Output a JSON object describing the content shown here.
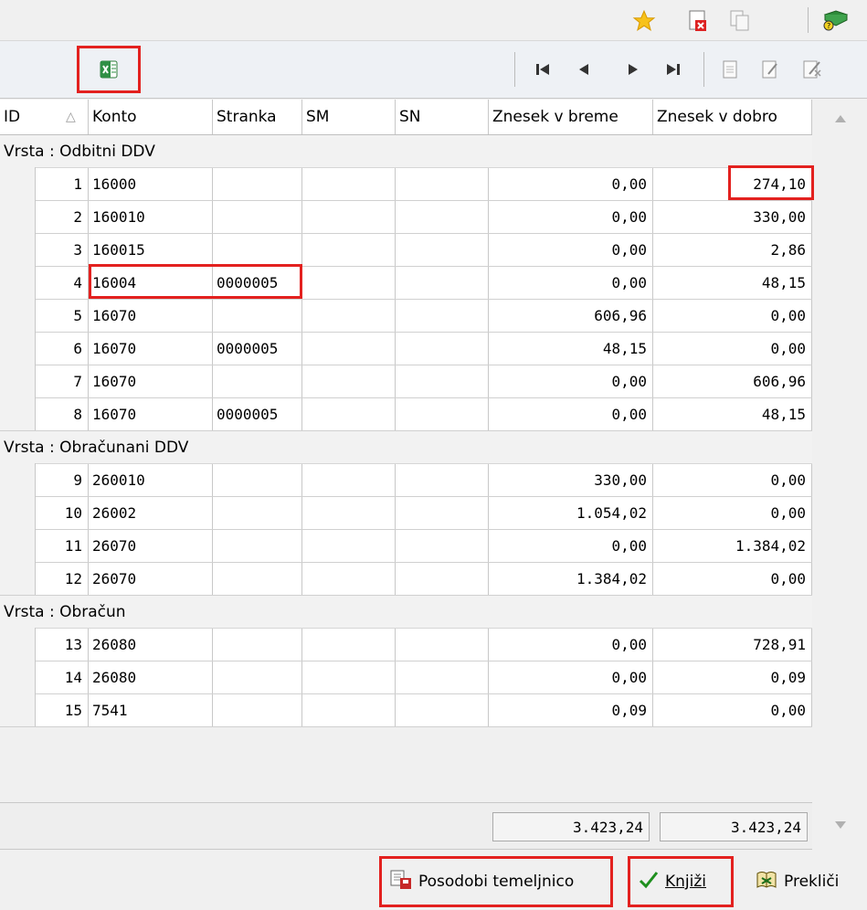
{
  "top_icons": [
    "star-icon",
    "delete-document-icon",
    "copy-document-icon",
    "book-help-icon"
  ],
  "toolbar": {
    "export_icon": "excel-export-icon",
    "nav": [
      "first-record-icon",
      "previous-record-icon",
      "next-record-icon",
      "last-record-icon"
    ],
    "edit": [
      "new-document-icon",
      "edit-icon",
      "cancel-edit-icon"
    ]
  },
  "columns": [
    "ID",
    "Konto",
    "Stranka",
    "SM",
    "SN",
    "Znesek v breme",
    "Znesek v dobro"
  ],
  "sort_indicator": "△",
  "groups": [
    {
      "label": "Vrsta : Odbitni DDV",
      "rows": [
        {
          "id": "1",
          "konto": "16000",
          "stranka": "",
          "sm": "",
          "sn": "",
          "breme": "0,00",
          "dobro": "274,10"
        },
        {
          "id": "2",
          "konto": "160010",
          "stranka": "",
          "sm": "",
          "sn": "",
          "breme": "0,00",
          "dobro": "330,00"
        },
        {
          "id": "3",
          "konto": "160015",
          "stranka": "",
          "sm": "",
          "sn": "",
          "breme": "0,00",
          "dobro": "2,86"
        },
        {
          "id": "4",
          "konto": "16004",
          "stranka": "0000005",
          "sm": "",
          "sn": "",
          "breme": "0,00",
          "dobro": "48,15"
        },
        {
          "id": "5",
          "konto": "16070",
          "stranka": "",
          "sm": "",
          "sn": "",
          "breme": "606,96",
          "dobro": "0,00"
        },
        {
          "id": "6",
          "konto": "16070",
          "stranka": "0000005",
          "sm": "",
          "sn": "",
          "breme": "48,15",
          "dobro": "0,00"
        },
        {
          "id": "7",
          "konto": "16070",
          "stranka": "",
          "sm": "",
          "sn": "",
          "breme": "0,00",
          "dobro": "606,96"
        },
        {
          "id": "8",
          "konto": "16070",
          "stranka": "0000005",
          "sm": "",
          "sn": "",
          "breme": "0,00",
          "dobro": "48,15"
        }
      ]
    },
    {
      "label": "Vrsta : Obračunani DDV",
      "rows": [
        {
          "id": "9",
          "konto": "260010",
          "stranka": "",
          "sm": "",
          "sn": "",
          "breme": "330,00",
          "dobro": "0,00"
        },
        {
          "id": "10",
          "konto": "26002",
          "stranka": "",
          "sm": "",
          "sn": "",
          "breme": "1.054,02",
          "dobro": "0,00"
        },
        {
          "id": "11",
          "konto": "26070",
          "stranka": "",
          "sm": "",
          "sn": "",
          "breme": "0,00",
          "dobro": "1.384,02"
        },
        {
          "id": "12",
          "konto": "26070",
          "stranka": "",
          "sm": "",
          "sn": "",
          "breme": "1.384,02",
          "dobro": "0,00"
        }
      ]
    },
    {
      "label": "Vrsta : Obračun",
      "rows": [
        {
          "id": "13",
          "konto": "26080",
          "stranka": "",
          "sm": "",
          "sn": "",
          "breme": "0,00",
          "dobro": "728,91"
        },
        {
          "id": "14",
          "konto": "26080",
          "stranka": "",
          "sm": "",
          "sn": "",
          "breme": "0,00",
          "dobro": "0,09"
        },
        {
          "id": "15",
          "konto": "7541",
          "stranka": "",
          "sm": "",
          "sn": "",
          "breme": "0,09",
          "dobro": "0,00"
        }
      ]
    }
  ],
  "totals": {
    "breme": "3.423,24",
    "dobro": "3.423,24"
  },
  "buttons": {
    "update": "Posodobi temeljnico",
    "post": "Knjiži",
    "cancel": "Prekliči"
  },
  "colors": {
    "highlight": "#e3211f",
    "group_bg": "#f2f2f2"
  }
}
